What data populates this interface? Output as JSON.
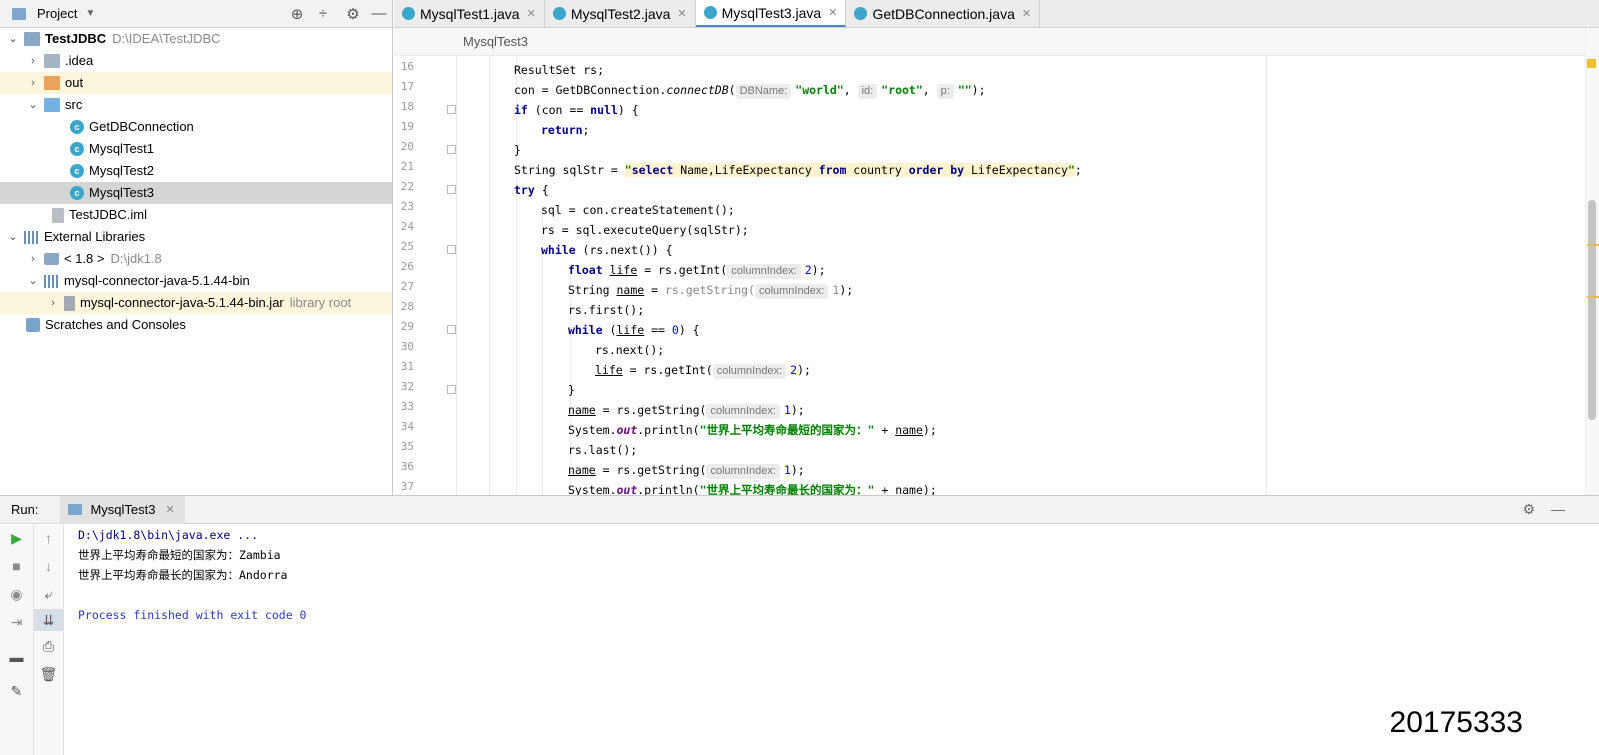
{
  "project_panel": {
    "title": "Project",
    "tree": [
      {
        "label": "TestJDBC",
        "detail": "D:\\IDEA\\TestJDBC"
      },
      {
        "label": ".idea"
      },
      {
        "label": "out"
      },
      {
        "label": "src"
      },
      {
        "label": "GetDBConnection"
      },
      {
        "label": "MysqlTest1"
      },
      {
        "label": "MysqlTest2"
      },
      {
        "label": "MysqlTest3"
      },
      {
        "label": "TestJDBC.iml"
      },
      {
        "label": "External Libraries"
      },
      {
        "label": "< 1.8 >",
        "detail": "D:\\jdk1.8"
      },
      {
        "label": "mysql-connector-java-5.1.44-bin"
      },
      {
        "label": "mysql-connector-java-5.1.44-bin.jar",
        "detail": "library root"
      },
      {
        "label": "Scratches and Consoles"
      }
    ]
  },
  "editor": {
    "tabs": [
      {
        "label": "MysqlTest1.java"
      },
      {
        "label": "MysqlTest2.java"
      },
      {
        "label": "MysqlTest3.java"
      },
      {
        "label": "GetDBConnection.java"
      }
    ],
    "breadcrumb": "MysqlTest3",
    "line_numbers": [
      "16",
      "17",
      "18",
      "19",
      "20",
      "21",
      "22",
      "23",
      "24",
      "25",
      "26",
      "27",
      "28",
      "29",
      "30",
      "31",
      "32",
      "33",
      "34",
      "35",
      "36",
      "37"
    ],
    "code": {
      "l16": "ResultSet rs;",
      "l17_a": "con = GetDBConnection.",
      "l17_method": "connectDB",
      "l17_paren": "(",
      "l17_hint1": "DBName:",
      "l17_s1": "\"world\"",
      "l17_c1": ", ",
      "l17_hint2": "id:",
      "l17_s2": "\"root\"",
      "l17_c2": ", ",
      "l17_hint3": "p:",
      "l17_s3": "\"\"",
      "l17_end": ");",
      "l18_kw": "if",
      "l18_a": " (con == ",
      "l18_null": "null",
      "l18_b": ") {",
      "l19_kw": "return",
      "l19_end": ";",
      "l20": "}",
      "l21_a": "String sqlStr = ",
      "l21_q1": "\"",
      "l21_select": "select",
      "l21_name": " Name,LifeExpectancy ",
      "l21_from": "from",
      "l21_country": " country ",
      "l21_order": "order by",
      "l21_le": " LifeExpectancy",
      "l21_q2": "\"",
      "l21_end": ";",
      "l22_kw": "try",
      "l22_b": " {",
      "l23": "sql = con.createStatement();",
      "l24": "rs = sql.executeQuery(sqlStr);",
      "l25_kw": "while",
      "l25_b": " (rs.next()) {",
      "l26_kw": "float",
      "l26_sp": " ",
      "l26_var": "life",
      "l26_b": " = rs.getInt(",
      "l26_hint": "columnIndex:",
      "l26_num": "2",
      "l26_end": ");",
      "l27_a": "String ",
      "l27_var": "name",
      "l27_b": " = ",
      "l27_hinttxt": "rs.getString(",
      "l27_hint": "columnIndex:",
      "l27_num": "1",
      "l27_end": ");",
      "l28": "rs.first();",
      "l29_kw": "while",
      "l29_a": " (",
      "l29_var": "life",
      "l29_b": " == ",
      "l29_num": "0",
      "l29_c": ") {",
      "l30": "rs.next();",
      "l31_var": "life",
      "l31_b": " = rs.getInt(",
      "l31_hint": "columnIndex:",
      "l31_num": "2",
      "l31_end": ");",
      "l32": "}",
      "l33_var": "name",
      "l33_b": " = rs.getString(",
      "l33_hint": "columnIndex:",
      "l33_num": "1",
      "l33_end": ");",
      "l34_a": "System.",
      "l34_out": "out",
      "l34_b": ".println(",
      "l34_str": "\"世界上平均寿命最短的国家为：\"",
      "l34_c": " + ",
      "l34_var": "name",
      "l34_end": ");",
      "l35": "rs.last();",
      "l36_var": "name",
      "l36_b": " = rs.getString(",
      "l36_hint": "columnIndex:",
      "l36_num": "1",
      "l36_end": ");",
      "l37_a": "System.",
      "l37_out": "out",
      "l37_b": ".println(",
      "l37_str": "\"世界上平均寿命最长的国家为：\"",
      "l37_c": " + ",
      "l37_var": "name",
      "l37_end": ");"
    }
  },
  "run_panel": {
    "label": "Run:",
    "tab": "MysqlTest3",
    "console": [
      "D:\\jdk1.8\\bin\\java.exe ...",
      "世界上平均寿命最短的国家为：Zambia",
      "世界上平均寿命最长的国家为：Andorra",
      "",
      "Process finished with exit code 0"
    ]
  },
  "watermark": "20175333",
  "colors": {
    "keyword": "#000080",
    "string": "#008000",
    "static_field": "#660e7a",
    "selection": "#d5d5d5",
    "run_green": "#3aa83a"
  }
}
